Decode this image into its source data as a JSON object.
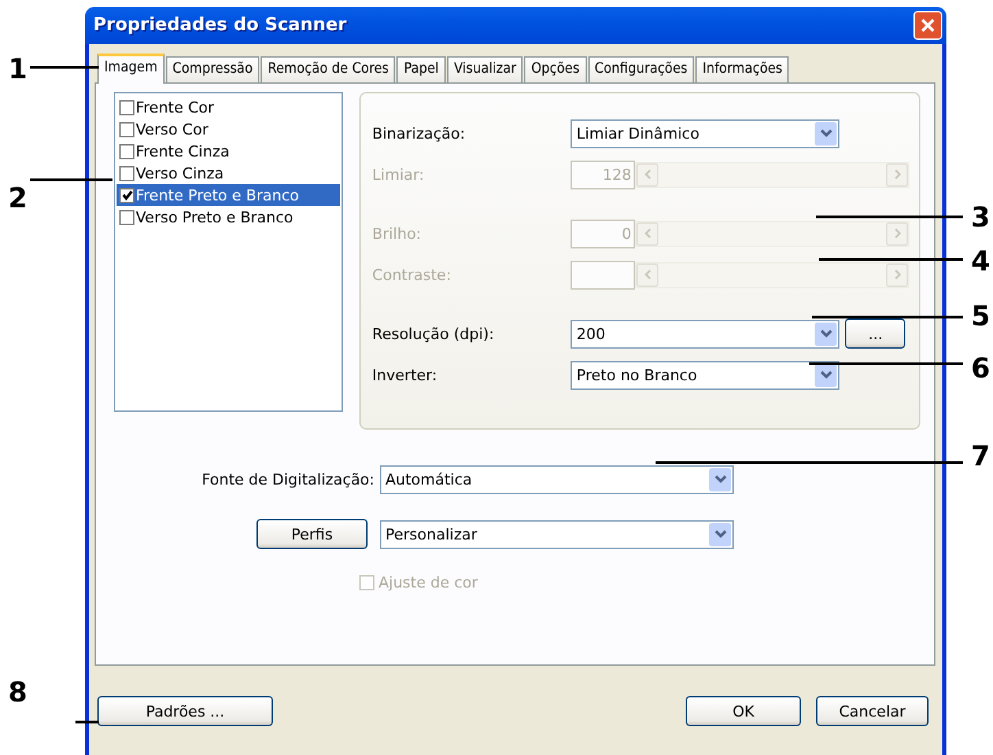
{
  "window": {
    "title": "Propriedades do Scanner"
  },
  "tabs": [
    {
      "label": "Imagem",
      "selected": true
    },
    {
      "label": "Compressão",
      "selected": false
    },
    {
      "label": "Remoção de Cores",
      "selected": false
    },
    {
      "label": "Papel",
      "selected": false
    },
    {
      "label": "Visualizar",
      "selected": false
    },
    {
      "label": "Opções",
      "selected": false
    },
    {
      "label": "Configurações",
      "selected": false
    },
    {
      "label": "Informações",
      "selected": false
    }
  ],
  "image_types": [
    {
      "label": "Frente Cor",
      "checked": false,
      "selected": false
    },
    {
      "label": "Verso Cor",
      "checked": false,
      "selected": false
    },
    {
      "label": "Frente Cinza",
      "checked": false,
      "selected": false
    },
    {
      "label": "Verso Cinza",
      "checked": false,
      "selected": false
    },
    {
      "label": "Frente Preto e Branco",
      "checked": true,
      "selected": true
    },
    {
      "label": "Verso Preto e Branco",
      "checked": false,
      "selected": false
    }
  ],
  "settings": [
    {
      "kind": "dropdown",
      "label": "Binarização:",
      "value": "Limiar Dinâmico",
      "disabled": false
    },
    {
      "kind": "slider",
      "label": "Limiar:",
      "value": "128",
      "disabled": true
    },
    {
      "kind": "gap"
    },
    {
      "kind": "slider",
      "label": "Brilho:",
      "value": "0",
      "disabled": true
    },
    {
      "kind": "slider",
      "label": "Contraste:",
      "disabled": true
    },
    {
      "kind": "gap"
    },
    {
      "kind": "dropdown",
      "label": "Resolução (dpi):",
      "value": "200",
      "disabled": false,
      "button": "..."
    },
    {
      "kind": "dropdown",
      "label": "Inverter:",
      "value": "Preto no Branco",
      "disabled": false
    }
  ],
  "scan_source": {
    "label": "Fonte de Digitalização:",
    "value": "Automática"
  },
  "profiles": {
    "button": "Perfis",
    "value": "Personalizar"
  },
  "color_adjust": {
    "label": "Ajuste de cor",
    "checked": false,
    "disabled": true
  },
  "buttons": {
    "defaults": "Padrões ...",
    "ok": "OK",
    "cancel": "Cancelar"
  },
  "callouts": [
    "1",
    "2",
    "3",
    "4",
    "5",
    "6",
    "7",
    "8"
  ]
}
